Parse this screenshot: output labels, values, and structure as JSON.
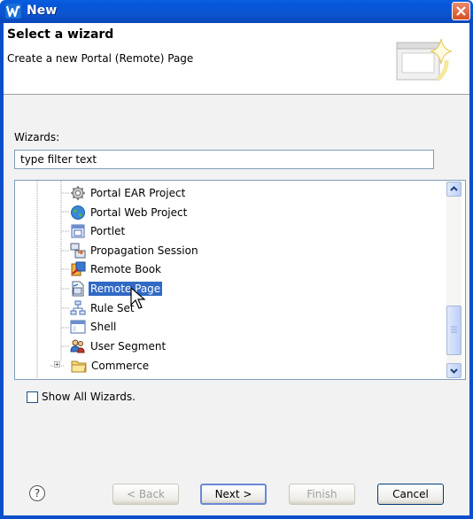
{
  "window": {
    "title": "New",
    "app_icon": "w-logo-icon",
    "close_icon": "close-icon"
  },
  "banner": {
    "title": "Select a wizard",
    "description": "Create a new Portal (Remote) Page",
    "image_icon": "wizard-banner-icon"
  },
  "wizards": {
    "label": "Wizards:",
    "filter_value": "type filter text",
    "items": [
      {
        "label": "Portal EAR Project",
        "icon": "gear-icon"
      },
      {
        "label": "Portal Web Project",
        "icon": "globe-icon"
      },
      {
        "label": "Portlet",
        "icon": "portlet-icon"
      },
      {
        "label": "Propagation Session",
        "icon": "propagation-icon"
      },
      {
        "label": "Remote Book",
        "icon": "remote-book-icon"
      },
      {
        "label": "Remote Page",
        "icon": "remote-page-icon",
        "selected": true
      },
      {
        "label": "Rule Set",
        "icon": "rule-set-icon"
      },
      {
        "label": "Shell",
        "icon": "shell-icon"
      },
      {
        "label": "User Segment",
        "icon": "user-segment-icon"
      },
      {
        "label": "Commerce",
        "icon": "folder-icon",
        "expandable": true
      }
    ]
  },
  "show_all": {
    "label": "Show All Wizards.",
    "checked": false
  },
  "buttons": {
    "help": "?",
    "back": "< Back",
    "next": "Next >",
    "finish": "Finish",
    "cancel": "Cancel"
  }
}
